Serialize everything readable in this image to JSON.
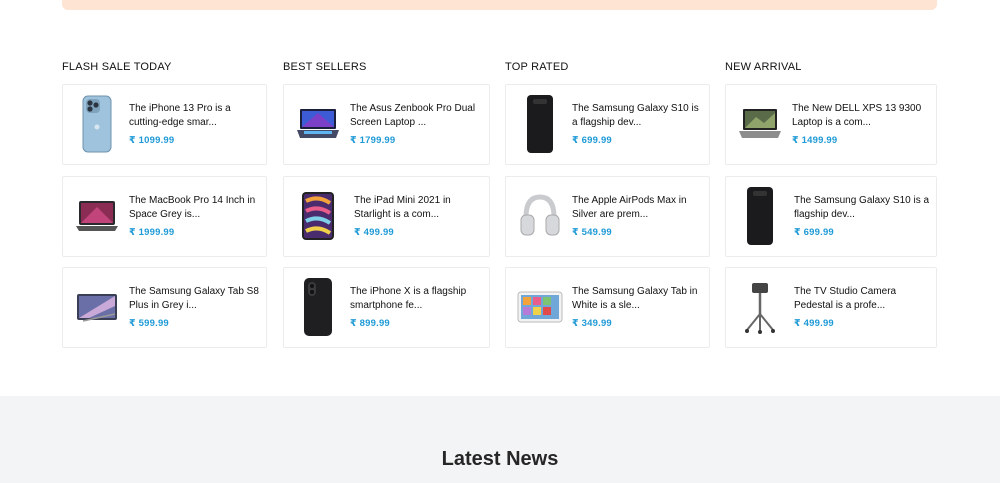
{
  "columns": [
    {
      "heading": "FLASH SALE TODAY",
      "items": [
        {
          "title": "The iPhone 13 Pro is a cutting-edge smar...",
          "price": "₹ 1099.99",
          "icon": "iphone-13-pro-icon"
        },
        {
          "title": "The MacBook Pro 14 Inch in Space Grey is...",
          "price": "₹ 1999.99",
          "icon": "macbook-pro-icon"
        },
        {
          "title": "The Samsung Galaxy Tab S8 Plus in Grey i...",
          "price": "₹ 599.99",
          "icon": "galaxy-tab-s8-icon"
        }
      ]
    },
    {
      "heading": "BEST SELLERS",
      "items": [
        {
          "title": "The Asus Zenbook Pro Dual Screen Laptop ...",
          "price": "₹ 1799.99",
          "icon": "asus-zenbook-icon"
        },
        {
          "title": "The iPad Mini 2021 in Starlight is a com...",
          "price": "₹ 499.99",
          "icon": "ipad-mini-icon"
        },
        {
          "title": "The iPhone X is a flagship smartphone fe...",
          "price": "₹ 899.99",
          "icon": "iphone-x-icon"
        }
      ]
    },
    {
      "heading": "TOP RATED",
      "items": [
        {
          "title": "The Samsung Galaxy S10 is a flagship dev...",
          "price": "₹ 699.99",
          "icon": "galaxy-s10-icon"
        },
        {
          "title": "The Apple AirPods Max in Silver are prem...",
          "price": "₹ 549.99",
          "icon": "airpods-max-icon"
        },
        {
          "title": "The Samsung Galaxy Tab in White is a sle...",
          "price": "₹ 349.99",
          "icon": "galaxy-tab-white-icon"
        }
      ]
    },
    {
      "heading": "NEW ARRIVAL",
      "items": [
        {
          "title": "The New DELL XPS 13 9300 Laptop is a com...",
          "price": "₹ 1499.99",
          "icon": "dell-xps-icon"
        },
        {
          "title": "The Samsung Galaxy S10 is a flagship dev...",
          "price": "₹ 699.99",
          "icon": "galaxy-s10-icon"
        },
        {
          "title": "The TV Studio Camera Pedestal is a profe...",
          "price": "₹ 499.99",
          "icon": "camera-pedestal-icon"
        }
      ]
    }
  ],
  "news": {
    "title": "Latest News"
  },
  "colors": {
    "price": "#1f9ad6",
    "banner": "#fde4d3",
    "news_bg": "#f3f4f5"
  }
}
